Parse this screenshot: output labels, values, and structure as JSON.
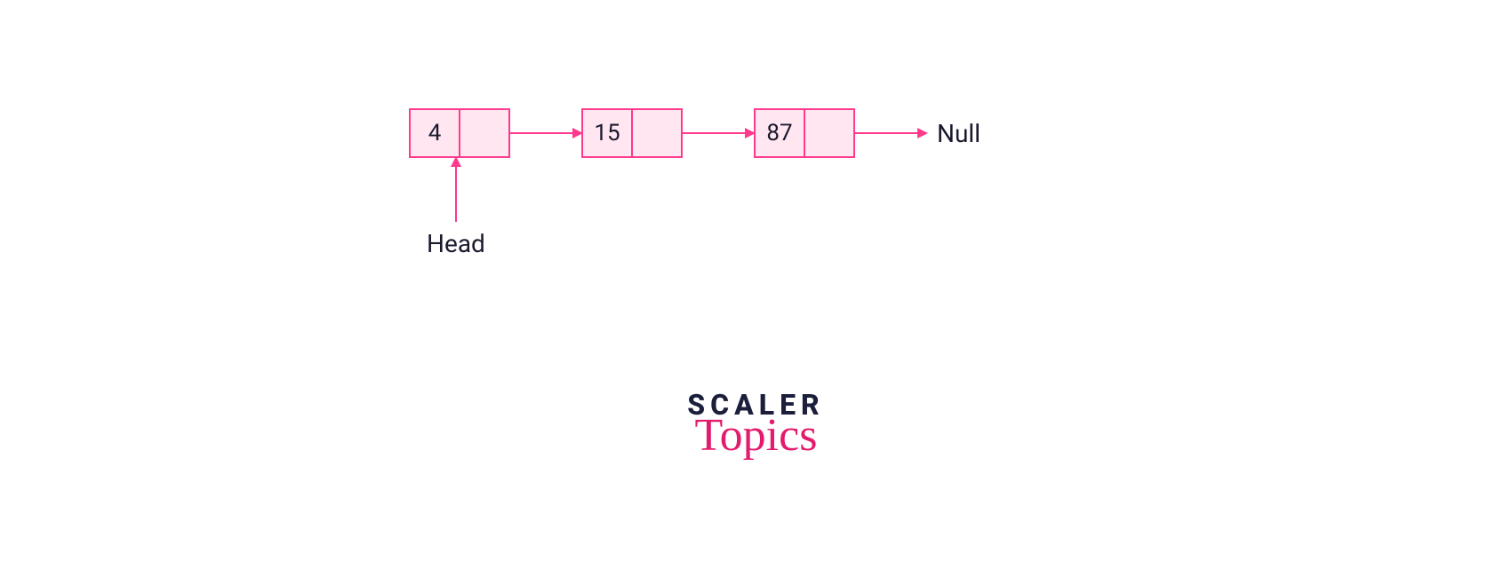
{
  "linked_list": {
    "nodes": [
      "4",
      "15",
      "87"
    ],
    "terminal": "Null",
    "head_label": "Head"
  },
  "branding": {
    "top": "SCALER",
    "bottom": "Topics"
  },
  "colors": {
    "accent": "#ff3a8c",
    "fill": "#ffe6f1",
    "text": "#1a1a2e",
    "brand_dark": "#1b1f3b",
    "brand_pink": "#e31b6d"
  }
}
